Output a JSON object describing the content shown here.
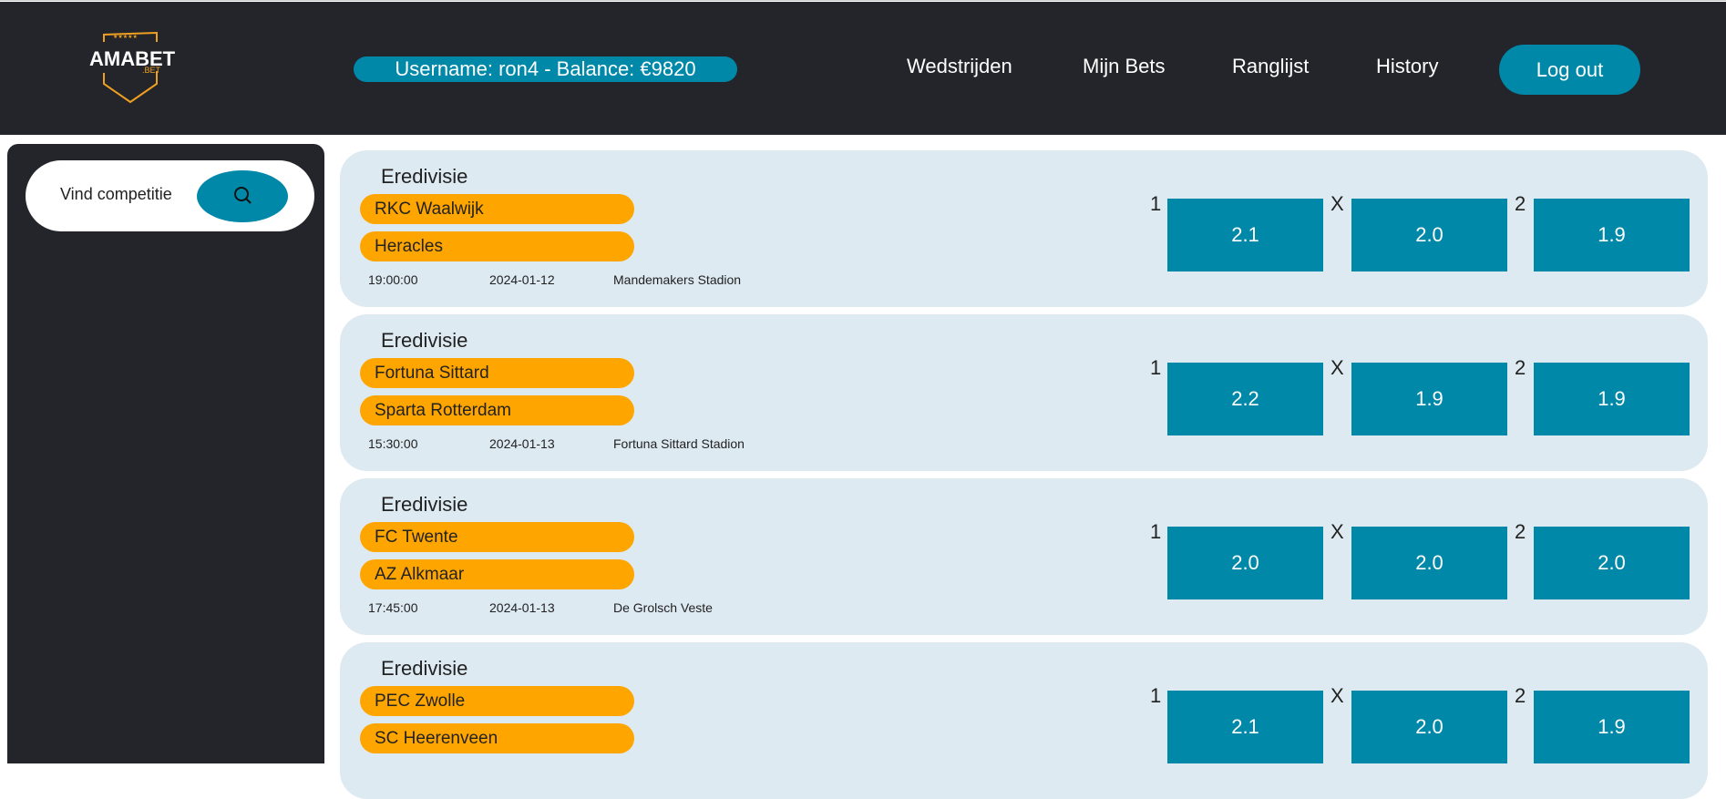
{
  "header": {
    "logo_text": "AMABET .BET",
    "user_info": "Username: ron4 - Balance: €9820",
    "nav": [
      "Wedstrijden",
      "Mijn Bets",
      "Ranglijst",
      "History"
    ],
    "logout": "Log out"
  },
  "sidebar": {
    "search_label": "Vind competitie"
  },
  "odds_labels": [
    "1",
    "X",
    "2"
  ],
  "matches": [
    {
      "competition": "Eredivisie",
      "home": "RKC Waalwijk",
      "away": "Heracles",
      "time": "19:00:00",
      "date": "2024-01-12",
      "venue": "Mandemakers Stadion",
      "odds": [
        "2.1",
        "2.0",
        "1.9"
      ]
    },
    {
      "competition": "Eredivisie",
      "home": "Fortuna Sittard",
      "away": "Sparta Rotterdam",
      "time": "15:30:00",
      "date": "2024-01-13",
      "venue": "Fortuna Sittard Stadion",
      "odds": [
        "2.2",
        "1.9",
        "1.9"
      ]
    },
    {
      "competition": "Eredivisie",
      "home": "FC Twente",
      "away": "AZ Alkmaar",
      "time": "17:45:00",
      "date": "2024-01-13",
      "venue": "De Grolsch Veste",
      "odds": [
        "2.0",
        "2.0",
        "2.0"
      ]
    },
    {
      "competition": "Eredivisie",
      "home": "PEC Zwolle",
      "away": "SC Heerenveen",
      "time": "",
      "date": "",
      "venue": "",
      "odds": [
        "2.1",
        "2.0",
        "1.9"
      ]
    }
  ],
  "colors": {
    "header": "#24252a",
    "accent": "#0088a9",
    "team": "#ffa500",
    "card": "#ddeaf2"
  }
}
